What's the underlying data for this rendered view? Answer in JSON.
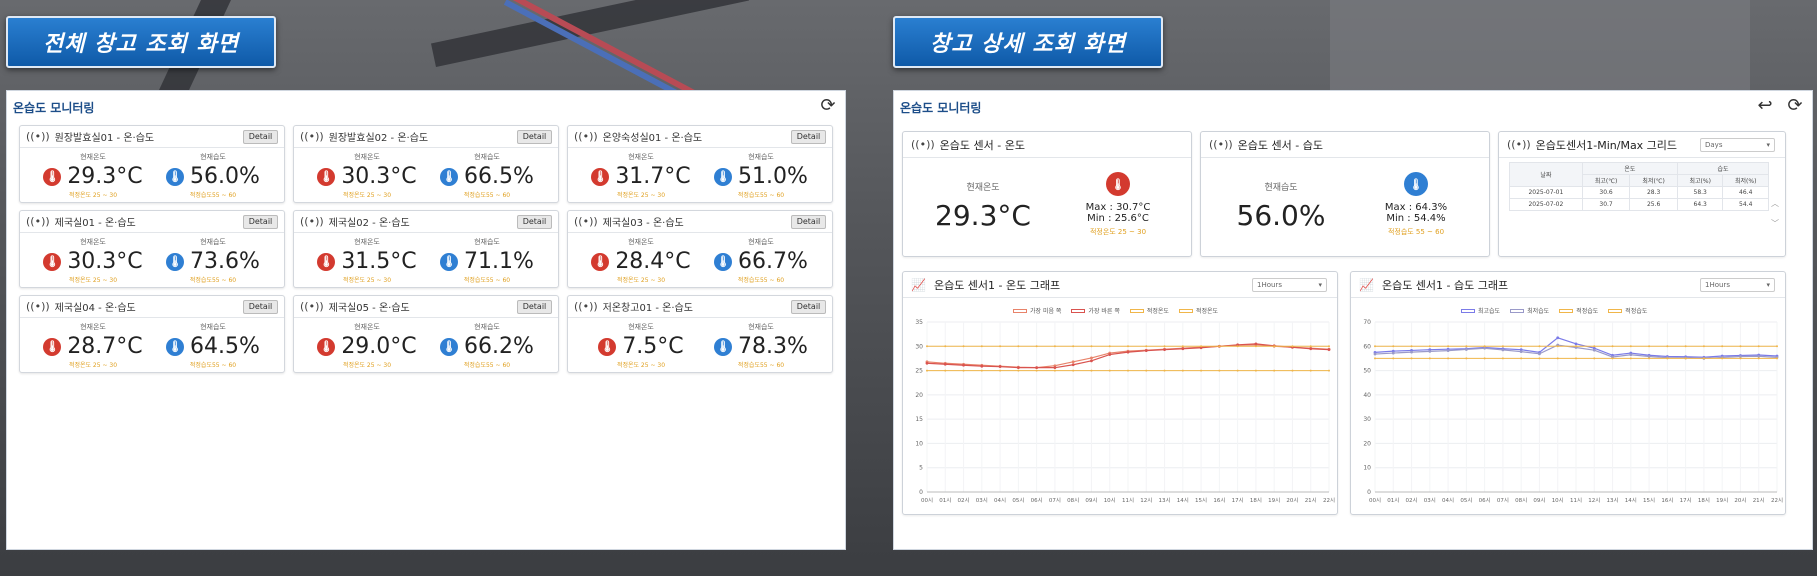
{
  "banners": {
    "left": "전체 창고 조회 화면",
    "right": "창고 상세 조회 화면"
  },
  "left_panel": {
    "title": "온습도 모니터링",
    "cards": [
      {
        "name": "원장발효실01 - 온·습도",
        "detail": "Detail",
        "temp_label": "현재온도",
        "temp": "29.3°C",
        "temp_range": "적정온도 25 ~ 30",
        "hum_label": "현재습도",
        "hum": "56.0%",
        "hum_range": "적정습도55 ~ 60"
      },
      {
        "name": "원장발효실02 - 온·습도",
        "detail": "Detail",
        "temp_label": "현재온도",
        "temp": "30.3°C",
        "temp_range": "적정온도 25 ~ 30",
        "hum_label": "현재습도",
        "hum": "66.5%",
        "hum_range": "적정습도55 ~ 60"
      },
      {
        "name": "온양숙성실01 - 온·습도",
        "detail": "Detail",
        "temp_label": "현재온도",
        "temp": "31.7°C",
        "temp_range": "적정온도 25 ~ 30",
        "hum_label": "현재습도",
        "hum": "51.0%",
        "hum_range": "적정습도55 ~ 60"
      },
      {
        "name": "제국실01 - 온·습도",
        "detail": "Detail",
        "temp_label": "현재온도",
        "temp": "30.3°C",
        "temp_range": "적정온도 25 ~ 30",
        "hum_label": "현재습도",
        "hum": "73.6%",
        "hum_range": "적정습도55 ~ 60"
      },
      {
        "name": "제국실02 - 온·습도",
        "detail": "Detail",
        "temp_label": "현재온도",
        "temp": "31.5°C",
        "temp_range": "적정온도 25 ~ 30",
        "hum_label": "현재습도",
        "hum": "71.1%",
        "hum_range": "적정습도55 ~ 60"
      },
      {
        "name": "제국실03 - 온·습도",
        "detail": "Detail",
        "temp_label": "현재온도",
        "temp": "28.4°C",
        "temp_range": "적정온도 25 ~ 30",
        "hum_label": "현재습도",
        "hum": "66.7%",
        "hum_range": "적정습도55 ~ 60"
      },
      {
        "name": "제국실04 - 온·습도",
        "detail": "Detail",
        "temp_label": "현재온도",
        "temp": "28.7°C",
        "temp_range": "적정온도 25 ~ 30",
        "hum_label": "현재습도",
        "hum": "64.5%",
        "hum_range": "적정습도55 ~ 60"
      },
      {
        "name": "제국실05 - 온·습도",
        "detail": "Detail",
        "temp_label": "현재온도",
        "temp": "29.0°C",
        "temp_range": "적정온도 25 ~ 30",
        "hum_label": "현재습도",
        "hum": "66.2%",
        "hum_range": "적정습도55 ~ 60"
      },
      {
        "name": "저온창고01 - 온·습도",
        "detail": "Detail",
        "temp_label": "현재온도",
        "temp": "7.5°C",
        "temp_range": "적정온도 25 ~ 30",
        "hum_label": "현재습도",
        "hum": "78.3%",
        "hum_range": "적정습도55 ~ 60"
      }
    ]
  },
  "right_panel": {
    "title": "온습도 모니터링",
    "temp_box": {
      "title": "온습도 센서 - 온도",
      "label": "현재온도",
      "value": "29.3°C",
      "max": "Max : 30.7°C",
      "min": "Min : 25.6°C",
      "range": "적정온도 25 ~ 30"
    },
    "hum_box": {
      "title": "온습도 센서 - 습도",
      "label": "현재습도",
      "value": "56.0%",
      "max": "Max : 64.3%",
      "min": "Min : 54.4%",
      "range": "적정습도 55 ~ 60"
    },
    "grid_box": {
      "title": "온습도센서1-Min/Max 그리드",
      "select": "Days",
      "header1": [
        "날짜",
        "온도",
        "습도"
      ],
      "header2": [
        "최고(℃)",
        "최저(℃)",
        "최고(%)",
        "최저(%)"
      ],
      "rows": [
        [
          "2025-07-01",
          "30.6",
          "28.3",
          "58.3",
          "46.4"
        ],
        [
          "2025-07-02",
          "30.7",
          "25.6",
          "64.3",
          "54.4"
        ]
      ]
    },
    "temp_chart": {
      "title": "온습도 센서1 - 온도 그래프",
      "select": "1Hours"
    },
    "hum_chart": {
      "title": "온습도 센서1 - 습도 그래프",
      "select": "1Hours"
    }
  },
  "colors": {
    "banner": "#1a6cc0",
    "title": "#1d4e89",
    "temp_icon": "#d33a2f",
    "hum_icon": "#2f7fd3",
    "range": "#e0a020"
  },
  "icons": {
    "refresh": "refresh-icon",
    "back": "back-arrow-icon",
    "sensor": "sensor-wave-icon",
    "chart": "line-chart-icon",
    "thermo": "thermometer-icon"
  },
  "chart_data": [
    {
      "type": "line",
      "title": "온습도 센서1 - 온도 그래프",
      "x": [
        "00시",
        "01시",
        "02시",
        "03시",
        "04시",
        "05시",
        "06시",
        "07시",
        "08시",
        "09시",
        "10시",
        "11시",
        "12시",
        "13시",
        "14시",
        "15시",
        "16시",
        "17시",
        "18시",
        "19시",
        "20시",
        "21시",
        "22시"
      ],
      "ylim": [
        0,
        35
      ],
      "yticks": [
        0,
        5,
        10,
        15,
        20,
        25,
        30,
        35
      ],
      "series": [
        {
          "name": "가장 미음 쪽",
          "color": "#e8836a",
          "values": [
            26.8,
            26.5,
            26.3,
            26.1,
            25.9,
            25.7,
            25.6,
            26.0,
            26.8,
            27.6,
            28.6,
            29.0,
            29.2,
            29.4,
            29.6,
            29.8,
            30.0,
            30.2,
            30.3,
            30.0,
            29.8,
            29.6,
            29.4
          ]
        },
        {
          "name": "가장 바른 쪽",
          "color": "#d9534f",
          "values": [
            26.5,
            26.3,
            26.1,
            25.9,
            25.8,
            25.6,
            25.6,
            25.6,
            26.2,
            27.0,
            28.3,
            28.8,
            29.1,
            29.3,
            29.5,
            29.7,
            30.0,
            30.3,
            30.5,
            30.1,
            29.8,
            29.5,
            29.3
          ]
        },
        {
          "name": "적정온도",
          "color": "#f0b64a",
          "values": [
            30,
            30,
            30,
            30,
            30,
            30,
            30,
            30,
            30,
            30,
            30,
            30,
            30,
            30,
            30,
            30,
            30,
            30,
            30,
            30,
            30,
            30,
            30
          ]
        },
        {
          "name": "적정온도",
          "color": "#f0b64a",
          "values": [
            25,
            25,
            25,
            25,
            25,
            25,
            25,
            25,
            25,
            25,
            25,
            25,
            25,
            25,
            25,
            25,
            25,
            25,
            25,
            25,
            25,
            25,
            25
          ]
        }
      ]
    },
    {
      "type": "line",
      "title": "온습도 센서1 - 습도 그래프",
      "x": [
        "00시",
        "01시",
        "02시",
        "03시",
        "04시",
        "05시",
        "06시",
        "07시",
        "08시",
        "09시",
        "10시",
        "11시",
        "12시",
        "13시",
        "14시",
        "15시",
        "16시",
        "17시",
        "18시",
        "19시",
        "20시",
        "21시",
        "22시"
      ],
      "ylim": [
        0,
        70
      ],
      "yticks": [
        0,
        10,
        20,
        30,
        40,
        50,
        60,
        70
      ],
      "series": [
        {
          "name": "최고습도",
          "color": "#7b7be8",
          "values": [
            57.5,
            58.0,
            58.3,
            58.6,
            58.8,
            59.0,
            59.5,
            59.0,
            58.6,
            57.5,
            63.5,
            61.0,
            59.2,
            56.3,
            57.2,
            56.3,
            55.8,
            55.7,
            55.5,
            56.0,
            56.2,
            56.4,
            56.0
          ]
        },
        {
          "name": "최저습도",
          "color": "#9a9ac9",
          "values": [
            56.8,
            57.2,
            57.6,
            57.9,
            58.2,
            58.7,
            59.2,
            58.5,
            57.8,
            56.9,
            60.5,
            59.5,
            58.4,
            55.6,
            56.5,
            55.8,
            55.3,
            55.2,
            55.0,
            55.4,
            55.8,
            55.9,
            55.4
          ]
        },
        {
          "name": "적정습도",
          "color": "#f0b64a",
          "values": [
            60,
            60,
            60,
            60,
            60,
            60,
            60,
            60,
            60,
            60,
            60,
            60,
            60,
            60,
            60,
            60,
            60,
            60,
            60,
            60,
            60,
            60,
            60
          ]
        },
        {
          "name": "적정습도",
          "color": "#f0b64a",
          "values": [
            55,
            55,
            55,
            55,
            55,
            55,
            55,
            55,
            55,
            55,
            55,
            55,
            55,
            55,
            55,
            55,
            55,
            55,
            55,
            55,
            55,
            55,
            55
          ]
        }
      ]
    }
  ]
}
